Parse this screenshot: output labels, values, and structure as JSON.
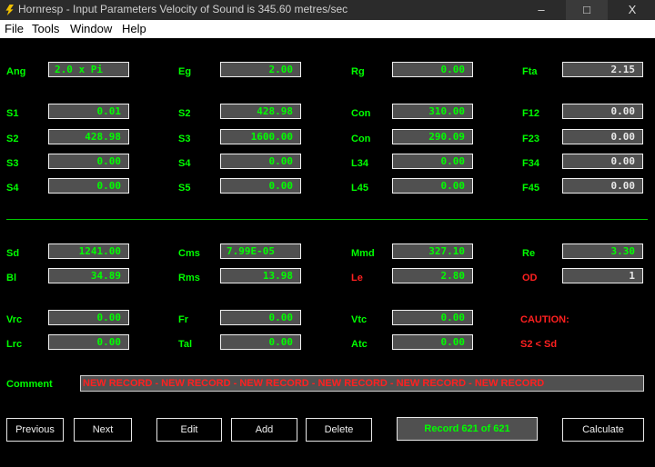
{
  "window": {
    "title": "Hornresp - Input Parameters   Velocity of Sound is 345.60 metres/sec",
    "minimize": "–",
    "maximize": "□",
    "close": "X"
  },
  "menu": [
    "File",
    "Tools",
    "Window",
    "Help"
  ],
  "fields": [
    {
      "label": "Ang",
      "value": "2.0 x Pi"
    },
    {
      "label": "Eg",
      "value": "2.00"
    },
    {
      "label": "Rg",
      "value": "0.00"
    },
    {
      "label": "Fta",
      "value": "2.15"
    },
    {
      "label": "S1",
      "value": "0.01"
    },
    {
      "label": "S2",
      "value": "428.98"
    },
    {
      "label": "Con",
      "value": "310.00"
    },
    {
      "label": "F12",
      "value": "0.00"
    },
    {
      "label": "S2",
      "value": "428.98"
    },
    {
      "label": "S3",
      "value": "1600.00"
    },
    {
      "label": "Con",
      "value": "290.09"
    },
    {
      "label": "F23",
      "value": "0.00"
    },
    {
      "label": "S3",
      "value": "0.00"
    },
    {
      "label": "S4",
      "value": "0.00"
    },
    {
      "label": "L34",
      "value": "0.00"
    },
    {
      "label": "F34",
      "value": "0.00"
    },
    {
      "label": "S4",
      "value": "0.00"
    },
    {
      "label": "S5",
      "value": "0.00"
    },
    {
      "label": "L45",
      "value": "0.00"
    },
    {
      "label": "F45",
      "value": "0.00"
    },
    {
      "label": "Sd",
      "value": "1241.00"
    },
    {
      "label": "Cms",
      "value": "7.99E-05"
    },
    {
      "label": "Mmd",
      "value": "327.10"
    },
    {
      "label": "Re",
      "value": "3.30"
    },
    {
      "label": "Bl",
      "value": "34.89"
    },
    {
      "label": "Rms",
      "value": "13.98"
    },
    {
      "label": "Le",
      "value": "2.80"
    },
    {
      "label": "OD",
      "value": "1"
    },
    {
      "label": "Vrc",
      "value": "0.00"
    },
    {
      "label": "Fr",
      "value": "0.00"
    },
    {
      "label": "Vtc",
      "value": "0.00"
    },
    {
      "label": "Lrc",
      "value": "0.00"
    },
    {
      "label": "Tal",
      "value": "0.00"
    },
    {
      "label": "Atc",
      "value": "0.00"
    }
  ],
  "caution": {
    "title": "CAUTION:",
    "message": "S2 < Sd"
  },
  "comment": {
    "label": "Comment",
    "value": "NEW RECORD - NEW RECORD - NEW RECORD - NEW RECORD - NEW RECORD - NEW RECORD"
  },
  "buttons": {
    "previous": "Previous",
    "next": "Next",
    "edit": "Edit",
    "add": "Add",
    "delete": "Delete",
    "calculate": "Calculate"
  },
  "record_status": "Record 621 of 621",
  "colors": {
    "label": "#00ff00",
    "warning": "#ff2020",
    "field_bg": "#505050",
    "background": "#000000"
  }
}
